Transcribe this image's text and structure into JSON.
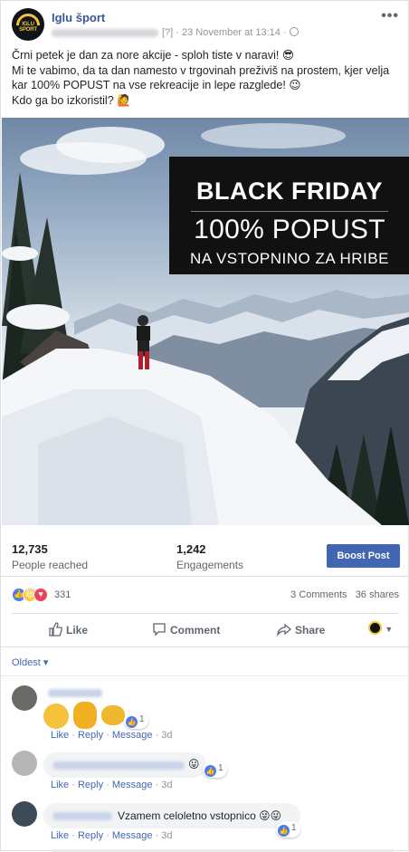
{
  "post": {
    "page_name": "Iglu šport",
    "avatar_text": "IGLU SPORT",
    "meta_unknown": "[?]",
    "timestamp": "· 23 November at 13:14 ·",
    "more": "•••",
    "text_line1": "Črni petek je dan za nore akcije - sploh tiste v naravi! 😎",
    "text_line2": "Mi te vabimo, da ta dan namesto v trgovinah preživiš na prostem, kjer velja kar 100% POPUST na vse rekreacije in lepe razglede! 😉",
    "text_line3": "Kdo ga bo izkoristil? 🙋"
  },
  "banner": {
    "line1": "BLACK FRIDAY",
    "line2": "100% POPUST",
    "line3": "NA VSTOPNINO ZA HRIBE"
  },
  "stats": {
    "reached_value": "12,735",
    "reached_label": "People reached",
    "engagements_value": "1,242",
    "engagements_label": "Engagements",
    "boost_label": "Boost Post"
  },
  "reactions": {
    "count": "331",
    "comments": "3 Comments",
    "shares": "36 shares"
  },
  "actions": {
    "like": "Like",
    "comment": "Comment",
    "share": "Share"
  },
  "comments_sort": "Oldest ▾",
  "comments": [
    {
      "like": "Like",
      "reply": "Reply",
      "message": "Message",
      "age": "3d",
      "likes": "1",
      "text": ""
    },
    {
      "like": "Like",
      "reply": "Reply",
      "message": "Message",
      "age": "3d",
      "likes": "1",
      "text": "😛"
    },
    {
      "like": "Like",
      "reply": "Reply",
      "message": "Message",
      "age": "3d",
      "likes": "1",
      "text": "Vzamem celoletno vstopnico 😜😜"
    }
  ],
  "colors": {
    "link_blue": "#365899",
    "boost_blue": "#4267b2",
    "like_blue": "#4a7bf0",
    "love_red": "#e9445a"
  }
}
